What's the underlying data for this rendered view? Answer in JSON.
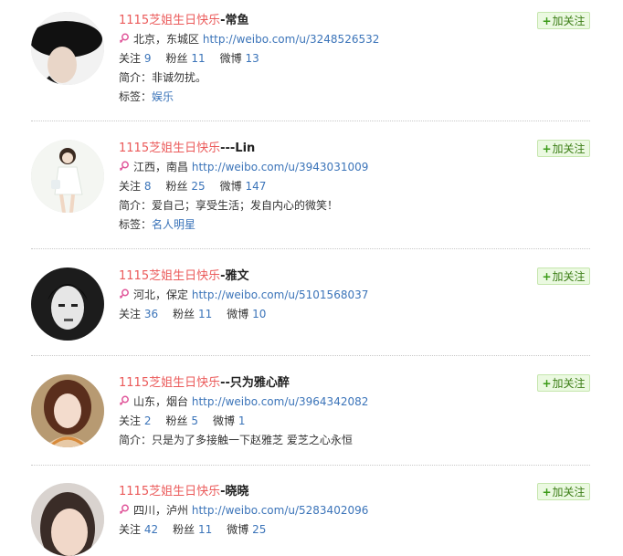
{
  "users": [
    {
      "name_prefix": "1115芝姐生日快乐",
      "name_suffix": "-常鱼",
      "location": "北京，东城区",
      "url": "http://weibo.com/u/3248526532",
      "follow_label": "关注",
      "following": "9",
      "fans_label": "粉丝",
      "fans": "11",
      "weibo_label": "微博",
      "weibo": "13",
      "intro_label": "简介：",
      "intro": "非诚勿扰。",
      "tag_label": "标签：",
      "tag": "娱乐",
      "button_label": "加关注"
    },
    {
      "name_prefix": "1115芝姐生日快乐",
      "name_suffix": "---Lin",
      "location": "江西，南昌",
      "url": "http://weibo.com/u/3943031009",
      "follow_label": "关注",
      "following": "8",
      "fans_label": "粉丝",
      "fans": "25",
      "weibo_label": "微博",
      "weibo": "147",
      "intro_label": "简介：",
      "intro": "爱自己；享受生活；发自内心的微笑！",
      "tag_label": "标签：",
      "tag": "名人明星",
      "button_label": "加关注"
    },
    {
      "name_prefix": "1115芝姐生日快乐",
      "name_suffix": "-雅文",
      "location": "河北，保定",
      "url": "http://weibo.com/u/5101568037",
      "follow_label": "关注",
      "following": "36",
      "fans_label": "粉丝",
      "fans": "11",
      "weibo_label": "微博",
      "weibo": "10",
      "button_label": "加关注"
    },
    {
      "name_prefix": "1115芝姐生日快乐",
      "name_suffix": "--只为雅心醉",
      "location": "山东，烟台",
      "url": "http://weibo.com/u/3964342082",
      "follow_label": "关注",
      "following": "2",
      "fans_label": "粉丝",
      "fans": "5",
      "weibo_label": "微博",
      "weibo": "1",
      "intro_label": "简介：",
      "intro": "只是为了多接触一下赵雅芝 爱芝之心永恒",
      "button_label": "加关注"
    },
    {
      "name_prefix": "1115芝姐生日快乐",
      "name_suffix": "-晓晓",
      "location": "四川，泸州",
      "url": "http://weibo.com/u/5283402096",
      "follow_label": "关注",
      "following": "42",
      "fans_label": "粉丝",
      "fans": "11",
      "weibo_label": "微博",
      "weibo": "25",
      "button_label": "加关注"
    }
  ]
}
